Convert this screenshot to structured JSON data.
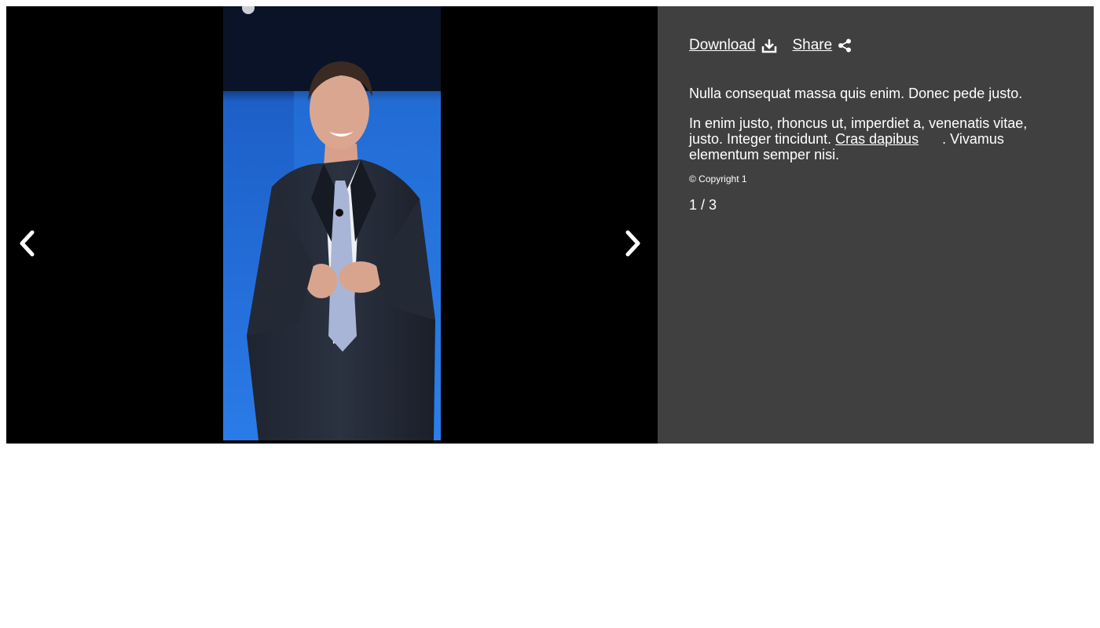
{
  "gallery": {
    "prev_icon": "chevron-left-icon",
    "next_icon": "chevron-right-icon",
    "photo_alt": "Man in a dark pinstripe suit speaking on stage in front of a blue backdrop"
  },
  "actions": {
    "download_label": "Download",
    "download_icon": "download-icon",
    "share_label": "Share",
    "share_icon": "share-icon"
  },
  "caption": {
    "paragraph1": "Nulla consequat massa quis enim. Donec pede justo.",
    "paragraph2_before": "In enim justo, rhoncus ut, imperdiet a, venenatis vitae, justo. Integer tincidunt. ",
    "paragraph2_link": "Cras dapibus",
    "paragraph2_after": ". Vivamus elementum semper nisi.",
    "copyright": "© Copyright 1"
  },
  "counter": "1 / 3",
  "colors": {
    "stage_bg": "#000000",
    "panel_bg": "#404040",
    "text": "#ffffff",
    "backdrop_blue": "#1f6fd6"
  }
}
